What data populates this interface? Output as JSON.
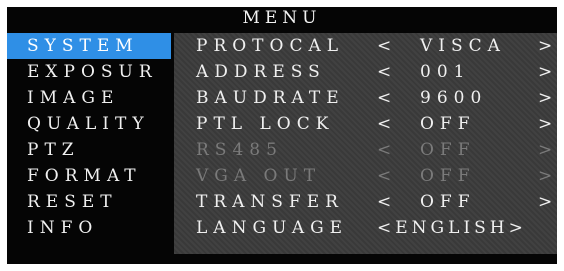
{
  "menu": {
    "title": "MENU",
    "categories": [
      {
        "label": "SYSTEM"
      },
      {
        "label": "EXPOSUR"
      },
      {
        "label": "IMAGE"
      },
      {
        "label": "QUALITY"
      },
      {
        "label": "PTZ"
      },
      {
        "label": "FORMAT"
      },
      {
        "label": "RESET"
      },
      {
        "label": "INFO"
      }
    ],
    "settings": [
      {
        "label": "PROTOCAL",
        "lt": "<",
        "value": "VISCA",
        "gt": ">"
      },
      {
        "label": "ADDRESS",
        "lt": "<",
        "value": "001",
        "gt": ">"
      },
      {
        "label": "BAUDRATE",
        "lt": "<",
        "value": "9600",
        "gt": ">"
      },
      {
        "label": "PTL LOCK",
        "lt": "<",
        "value": "OFF",
        "gt": ">"
      },
      {
        "label": "RS485",
        "lt": "<",
        "value": "OFF",
        "gt": ">"
      },
      {
        "label": "VGA OUT",
        "lt": "<",
        "value": "OFF",
        "gt": ">"
      },
      {
        "label": "TRANSFER",
        "lt": "<",
        "value": "OFF",
        "gt": ">"
      },
      {
        "label": "LANGUAGE",
        "value_full": "<ENGLISH>"
      }
    ]
  }
}
